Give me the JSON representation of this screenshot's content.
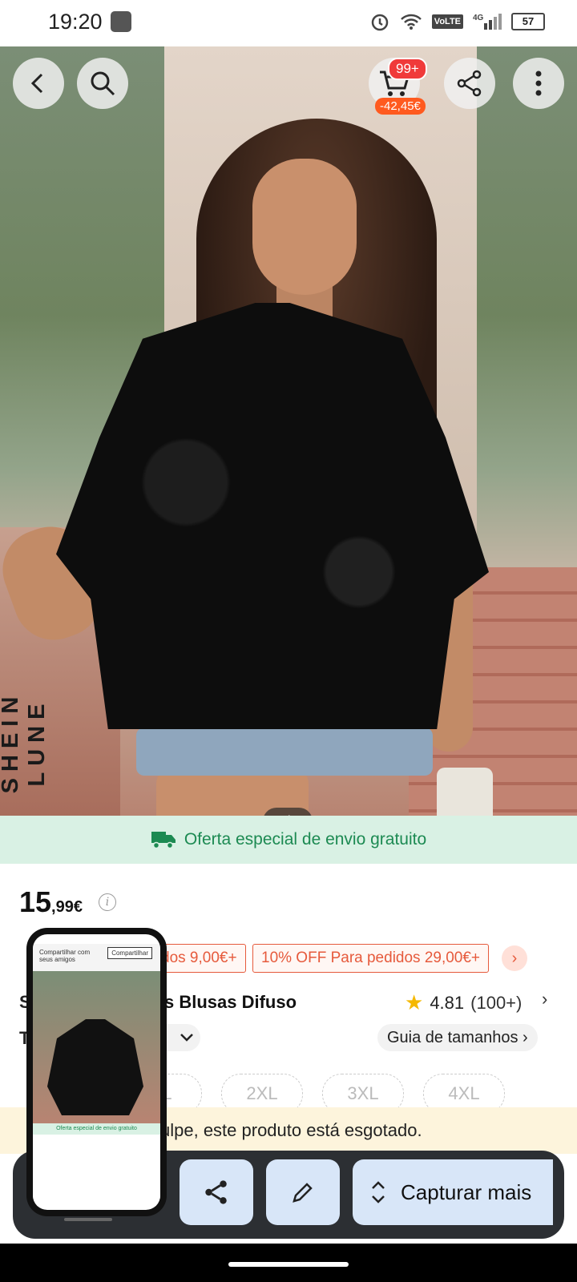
{
  "status_bar": {
    "time": "19:20",
    "network": "4G",
    "volte": "VoLTE",
    "battery": "57"
  },
  "product_image": {
    "brand": "SHEIN LUNE",
    "counter": "3 / 6",
    "cart_badge": "99+",
    "cart_price": "-42,45€"
  },
  "shipping_banner": {
    "text": "Oferta especial de envio gratuito"
  },
  "price": {
    "integer": "15",
    "decimal": ",99€"
  },
  "coupons": [
    "dos 9,00€+",
    "10% OFF Para pedidos 29,00€+"
  ],
  "product": {
    "title_prefix": "S",
    "title": "s Blusas Difuso",
    "rating": "4.81",
    "rating_count": "(100+)"
  },
  "size": {
    "prefix": "T",
    "guide_label": "Guia de tamanhos",
    "options": [
      "XL",
      "2XL",
      "3XL",
      "4XL"
    ]
  },
  "soldout": {
    "text": "ulpe, este produto está esgotado."
  },
  "capture_toolbar": {
    "capture_label": "Capturar mais"
  },
  "thumbnail": {
    "share_text": "Compartilhar com seus amigos",
    "share_button": "Compartilhar",
    "banner": "Oferta especial de envio gratuito"
  },
  "colors": {
    "accent": "#e65a3c",
    "shipping_green": "#1c8a52",
    "star": "#f5b800"
  }
}
